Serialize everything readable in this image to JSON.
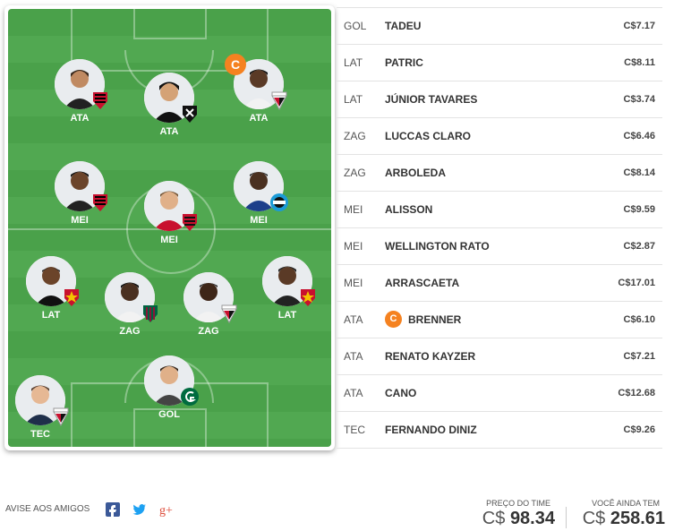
{
  "field": {
    "players": [
      {
        "pos": "ATA",
        "club": "Atletico-GO",
        "captain": false
      },
      {
        "pos": "ATA",
        "club": "Vasco",
        "captain": false
      },
      {
        "pos": "ATA",
        "club": "Sao Paulo",
        "captain": true,
        "captain_mark": "C"
      },
      {
        "pos": "MEI",
        "club": "Atletico-GO",
        "captain": false
      },
      {
        "pos": "MEI",
        "club": "Flamengo",
        "captain": false
      },
      {
        "pos": "MEI",
        "club": "Gremio",
        "captain": false
      },
      {
        "pos": "LAT",
        "club": "Sport",
        "captain": false
      },
      {
        "pos": "ZAG",
        "club": "Fluminense",
        "captain": false
      },
      {
        "pos": "ZAG",
        "club": "Sao Paulo",
        "captain": false
      },
      {
        "pos": "LAT",
        "club": "Sport",
        "captain": false
      },
      {
        "pos": "GOL",
        "club": "Goias",
        "captain": false
      },
      {
        "pos": "TEC",
        "club": "Sao Paulo",
        "captain": false
      }
    ]
  },
  "list": {
    "rows": [
      {
        "pos": "GOL",
        "name": "TADEU",
        "price": "C$7.17"
      },
      {
        "pos": "LAT",
        "name": "PATRIC",
        "price": "C$8.11"
      },
      {
        "pos": "LAT",
        "name": "JÚNIOR TAVARES",
        "price": "C$3.74"
      },
      {
        "pos": "ZAG",
        "name": "LUCCAS CLARO",
        "price": "C$6.46"
      },
      {
        "pos": "ZAG",
        "name": "ARBOLEDA",
        "price": "C$8.14"
      },
      {
        "pos": "MEI",
        "name": "ALISSON",
        "price": "C$9.59"
      },
      {
        "pos": "MEI",
        "name": "WELLINGTON RATO",
        "price": "C$2.87"
      },
      {
        "pos": "MEI",
        "name": "ARRASCAETA",
        "price": "C$17.01"
      },
      {
        "pos": "ATA",
        "name": "BRENNER",
        "price": "C$6.10",
        "captain": "C"
      },
      {
        "pos": "ATA",
        "name": "RENATO KAYZER",
        "price": "C$7.21"
      },
      {
        "pos": "ATA",
        "name": "CANO",
        "price": "C$12.68"
      },
      {
        "pos": "TEC",
        "name": "FERNANDO DINIZ",
        "price": "C$9.26"
      }
    ]
  },
  "footer": {
    "share_label": "AVISE AOS AMIGOS",
    "team_price_label": "PREÇO DO TIME",
    "team_price_currency": "C$",
    "team_price_value": "98.34",
    "remaining_label": "VOCÊ AINDA TEM",
    "remaining_currency": "C$",
    "remaining_value": "258.61"
  },
  "colors": {
    "field_green": "#4aa14a",
    "captain_orange": "#f58220",
    "facebook": "#3b5998",
    "twitter": "#1da1f2",
    "google_plus": "#dd4b39"
  }
}
